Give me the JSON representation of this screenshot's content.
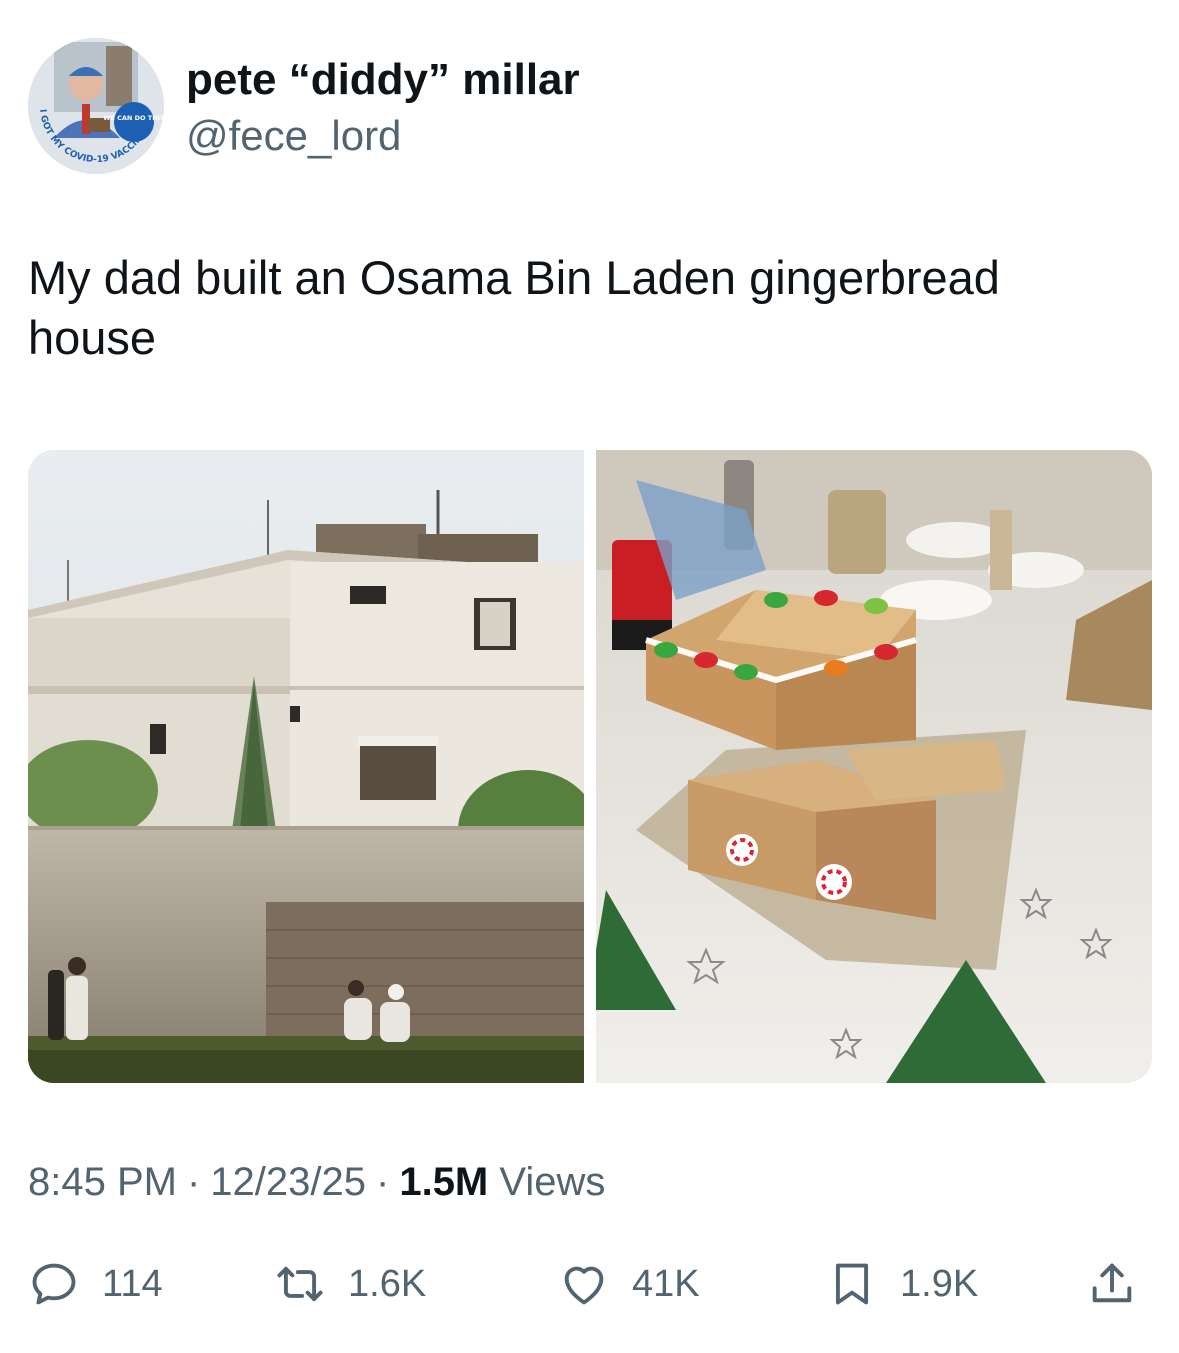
{
  "tweet": {
    "author": {
      "display_name": "pete “diddy” millar",
      "handle": "@fece_lord",
      "avatar_badge_text": "I GOT MY COVID-19 VACCINE",
      "avatar_sticker_text": "WE CAN DO THIS"
    },
    "text": "My dad built an Osama Bin Laden gingerbread house",
    "media": [
      {
        "name": "compound-photo"
      },
      {
        "name": "gingerbread-house-photo"
      }
    ],
    "meta": {
      "time": "8:45 PM",
      "date": "12/23/25",
      "separator": "·",
      "views_count": "1.5M",
      "views_label": "Views"
    },
    "actions": {
      "replies": "114",
      "reposts": "1.6K",
      "likes": "41K",
      "bookmarks": "1.9K"
    }
  },
  "icons": {
    "reply": "speech-bubble-icon",
    "repost": "repost-arrows-icon",
    "like": "heart-icon",
    "bookmark": "bookmark-icon",
    "share": "share-upload-icon"
  },
  "colors": {
    "text_primary": "#0f1419",
    "text_secondary": "#536471",
    "badge_blue": "#1d5fb3"
  }
}
